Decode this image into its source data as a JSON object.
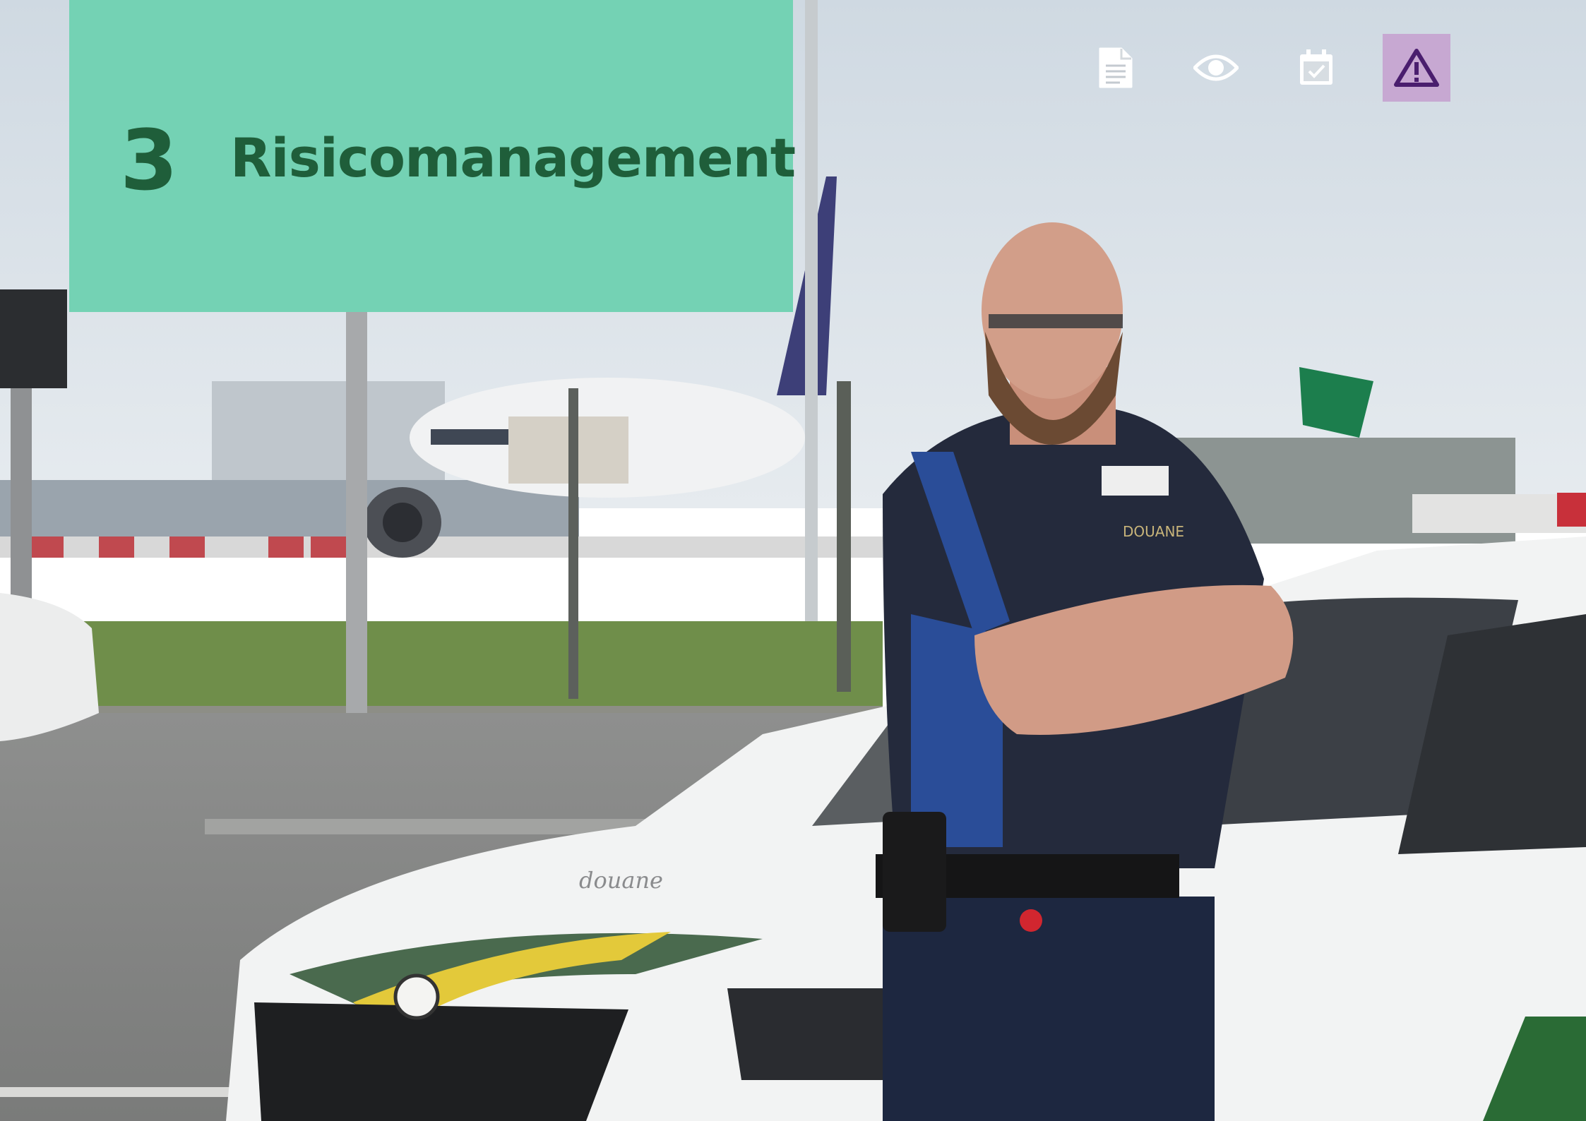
{
  "chapter": {
    "number": "3",
    "title": "Risicomanagement"
  },
  "photo": {
    "vehicle_text": "douane",
    "badge_text": "DOUANE"
  },
  "nav": {
    "items": [
      {
        "icon": "document-icon",
        "active": false
      },
      {
        "icon": "eye-icon",
        "active": false
      },
      {
        "icon": "calendar-check-icon",
        "active": false
      },
      {
        "icon": "warning-icon",
        "active": true
      }
    ]
  },
  "colors": {
    "title_block": "#74d2b4",
    "title_text": "#1f5e3a",
    "nav_active_bg": "#c7a8d2",
    "nav_active_icon": "#4a1e6e",
    "nav_icon": "#ffffff"
  }
}
